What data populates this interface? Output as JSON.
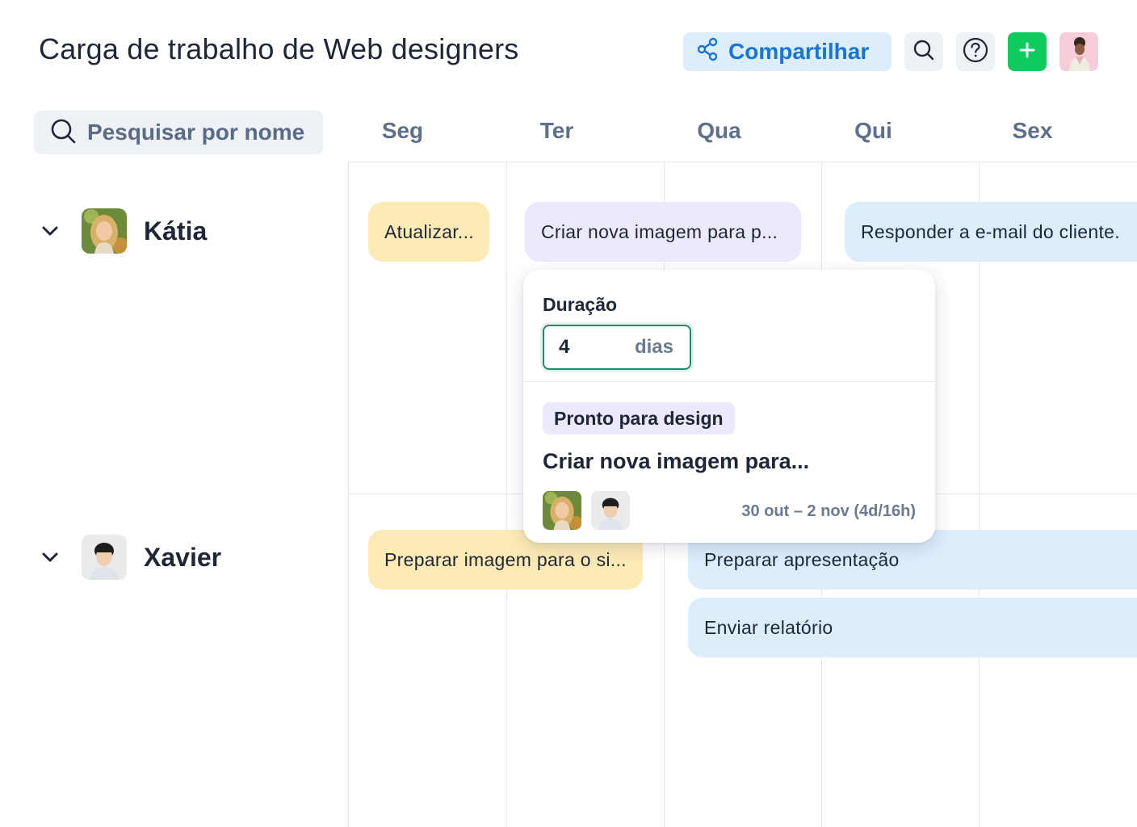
{
  "header": {
    "title": "Carga de trabalho de Web designers",
    "share_label": "Compartilhar"
  },
  "colors": {
    "accent": "#1a73d9",
    "add_button": "#0fcb5e",
    "task_yellow": "#fdebb5",
    "task_purple": "#ede9fd",
    "task_blue": "#dcedfc"
  },
  "search": {
    "placeholder": "Pesquisar por nome"
  },
  "days": [
    "Seg",
    "Ter",
    "Qua",
    "Qui",
    "Sex"
  ],
  "people": [
    {
      "name": "Kátia",
      "tasks": [
        {
          "label": "Atualizar...",
          "color": "yellow"
        },
        {
          "label": "Criar nova imagem para p...",
          "color": "purple"
        },
        {
          "label": "Responder a e-mail do cliente.",
          "color": "blue"
        }
      ]
    },
    {
      "name": "Xavier",
      "tasks": [
        {
          "label": "Preparar imagem para o si...",
          "color": "yellow"
        },
        {
          "label": "Preparar apresentação",
          "color": "blue"
        },
        {
          "label": "Enviar relatório",
          "color": "blue"
        }
      ]
    }
  ],
  "popover": {
    "duration_label": "Duração",
    "duration_value": "4",
    "duration_unit": "dias",
    "status": "Pronto para design",
    "task_title": "Criar nova imagem para...",
    "date_range": "30 out – 2 nov (4d/16h)"
  }
}
